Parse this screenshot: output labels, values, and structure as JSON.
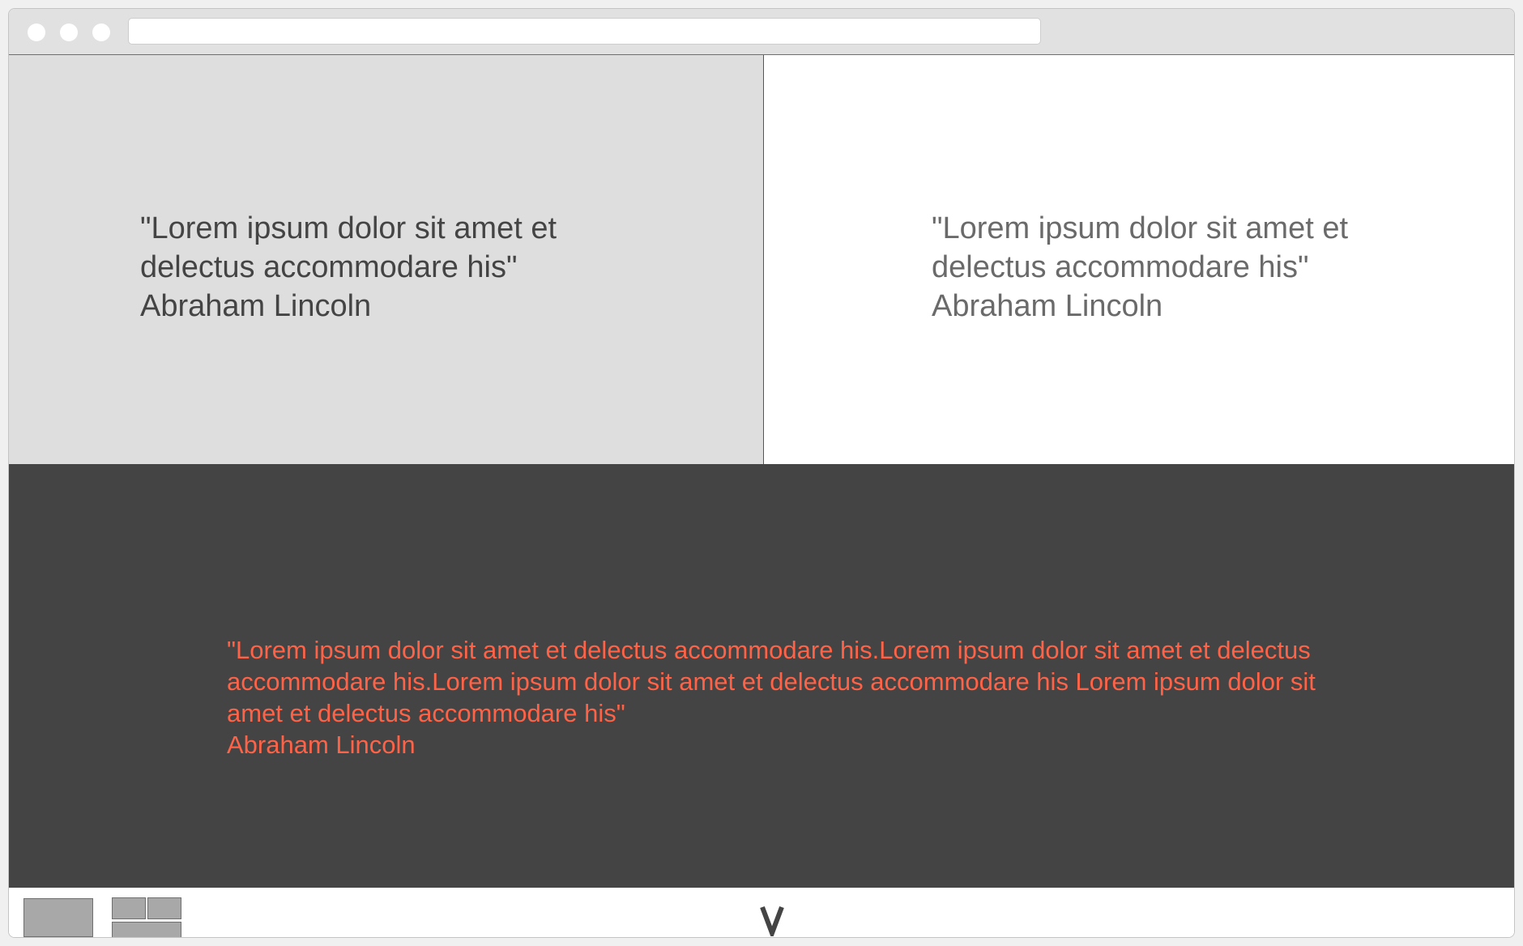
{
  "browser": {
    "window_controls": [
      "close-dot-icon",
      "minimize-dot-icon",
      "maximize-dot-icon"
    ],
    "address_value": ""
  },
  "panels": {
    "left": {
      "quote": "\"Lorem ipsum dolor sit amet et",
      "quote_line2": "delectus accommodare his\"",
      "author": "Abraham Lincoln",
      "background": "#dedede",
      "text_color": "#444444"
    },
    "right": {
      "quote": "\"Lorem ipsum dolor sit amet et",
      "quote_line2": "delectus accommodare his\"",
      "author": "Abraham Lincoln",
      "background": "#ffffff",
      "text_color": "#6a6a6a"
    },
    "bottom": {
      "quote": "\"Lorem ipsum dolor sit amet et delectus accommodare his.Lorem ipsum dolor sit amet et delectus accommodare his.Lorem ipsum dolor sit amet et delectus accommodare his Lorem ipsum dolor sit amet et delectus accommodare his\"",
      "author": "Abraham Lincoln",
      "background": "#444444",
      "text_color": "#ff6347"
    }
  },
  "footer": {
    "layout_options": [
      "single-layout-icon",
      "split-layout-icon"
    ],
    "scroll_indicator": "chevron-down-icon"
  }
}
